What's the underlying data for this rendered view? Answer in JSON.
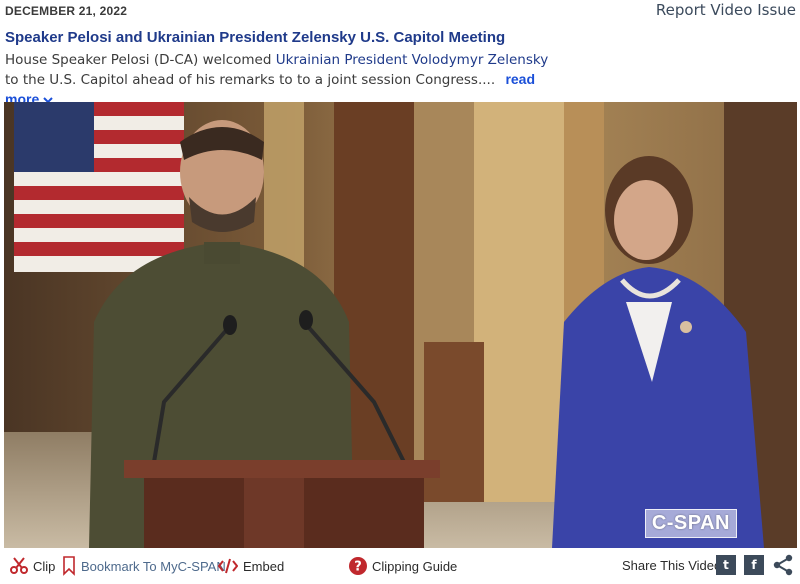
{
  "header": {
    "date": "DECEMBER 21, 2022",
    "report_label": "Report Video Issue"
  },
  "video": {
    "title": "Speaker Pelosi and Ukrainian President Zelensky U.S. Capitol Meeting",
    "desc_before": "House Speaker Pelosi (D-CA) welcomed ",
    "desc_link": "Ukrainian President Volodymyr Zelensky",
    "desc_after": " to the U.S. Capitol ahead of his remarks to to a joint session Congress....",
    "read_more": "read more",
    "watermark": "C-SPAN"
  },
  "toolbar": {
    "clip_label": "Clip",
    "bookmark_label": "Bookmark To MyC-SPAN",
    "embed_label": "Embed",
    "guide_label": "Clipping Guide",
    "share_label": "Share This Video",
    "twitter_glyph": "t",
    "facebook_glyph": "f"
  },
  "colors": {
    "title": "#1f3a8a",
    "link": "#1a4fd8",
    "clip_icon": "#c0282d",
    "social_bg": "#3c4a5a"
  },
  "icons": {
    "clip": "scissors-icon",
    "bookmark": "bookmark-icon",
    "embed": "code-icon",
    "guide": "question-circle-icon",
    "share": "share-icon"
  }
}
